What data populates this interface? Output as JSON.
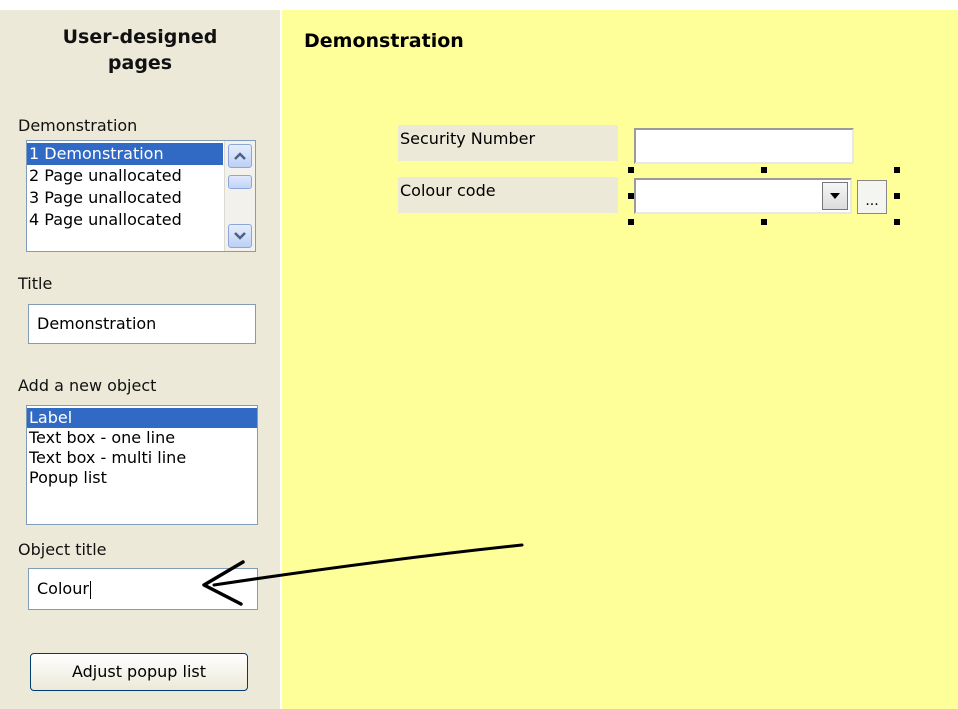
{
  "sidebar": {
    "title_line1": "User-designed",
    "title_line2": "pages",
    "pages_label": "Demonstration",
    "pages": [
      "1  Demonstration",
      "2  Page unallocated",
      "3  Page unallocated",
      "4  Page unallocated"
    ],
    "title_label": "Title",
    "title_value": "Demonstration",
    "add_object_label": "Add a new object",
    "object_types": [
      "Label",
      "Text box - one line",
      "Text box - multi line",
      "Popup list"
    ],
    "object_title_label": "Object title",
    "object_title_value": "Colour",
    "adjust_button": "Adjust popup list"
  },
  "canvas": {
    "title": "Demonstration",
    "fields": [
      {
        "label": "Security Number"
      },
      {
        "label": "Colour code"
      }
    ],
    "ellipsis_label": "...",
    "dropdown_arrow": "▼"
  },
  "icons": {
    "scroll_up": "chevron-up-icon",
    "scroll_down": "chevron-down-icon",
    "dropdown": "chevron-down-icon"
  },
  "colors": {
    "canvas_bg": "#ffff99",
    "sidebar_bg": "#ece9d8",
    "selection": "#316ac5"
  }
}
